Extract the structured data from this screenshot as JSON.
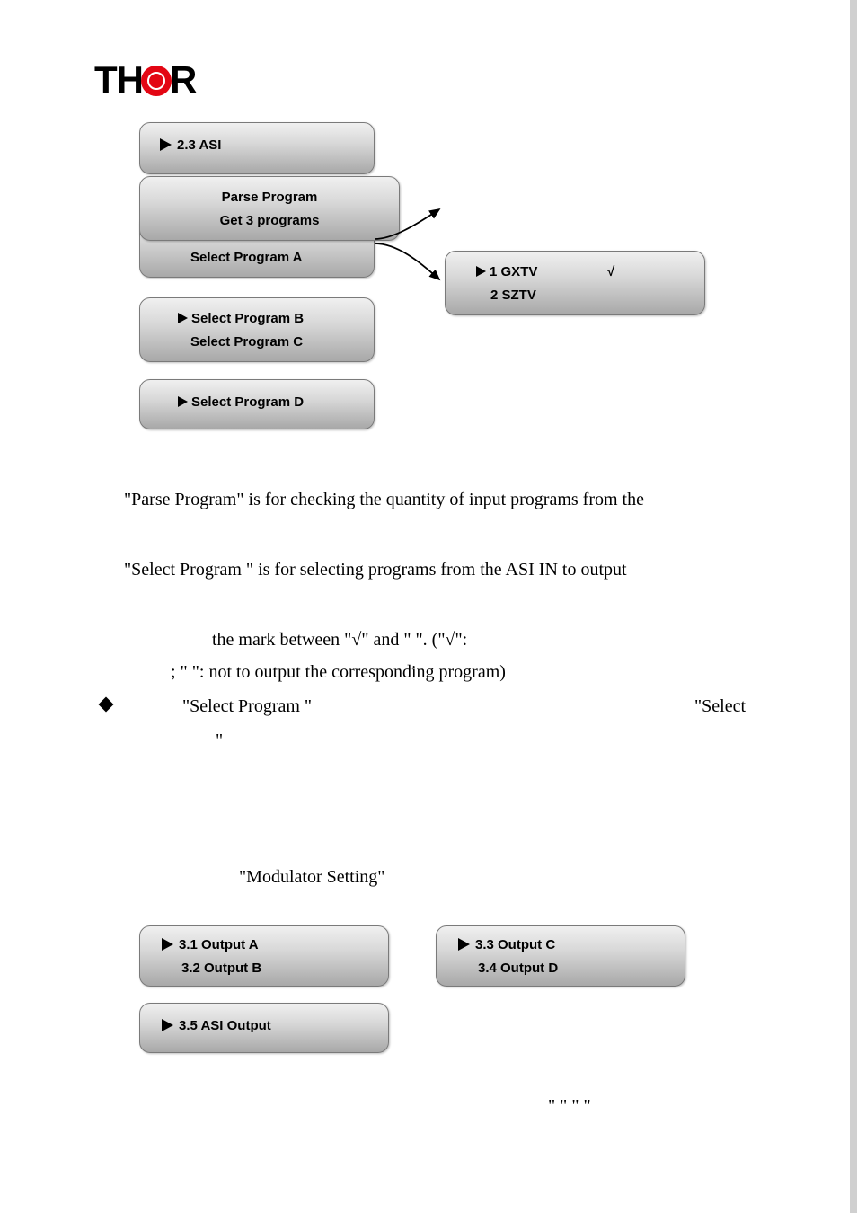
{
  "logo": {
    "left": "TH",
    "right": "R"
  },
  "diagram1": {
    "box_asi": {
      "line1": "2.3 ASI"
    },
    "box_parse_select_a": {
      "line1": "Parse Program",
      "line2": "Select Program A"
    },
    "box_select_bc": {
      "line1": "Select Program B",
      "line2": "Select Program C"
    },
    "box_select_d": {
      "line1": "Select Program D"
    },
    "box_parse_result": {
      "line1": "Parse Program",
      "line2": "Get 3 programs"
    },
    "box_channels": {
      "line1": "1 GXTV",
      "tick": "√",
      "line2": "2 SZTV"
    }
  },
  "text1": "\"Parse Program\" is for checking the quantity of input programs from the",
  "text2": "\"Select Program    \" is for selecting programs from the ASI IN to output",
  "text3_line1_a": "the mark between \"",
  "text3_line1_tick": "√",
  "text3_line1_b": "\" and \"  \". (\"",
  "text3_line1_tick2": "√",
  "text3_line1_c": "\":",
  "text3_line2": "; \"  \": not to output the corresponding program)",
  "text4_a": "\"Select Program         \"",
  "text4_b": "\"Select",
  "text4_c": "\"",
  "text5": "\"Modulator Setting\"",
  "diagram2": {
    "box_ab": {
      "line1": "3.1 Output A",
      "line2": "3.2 Output B"
    },
    "box_cd": {
      "line1": "3.3 Output C",
      "line2": "3.4 Output D"
    },
    "box_asi_out": {
      "line1": "3.5 ASI Output"
    }
  },
  "tail_quotes": "\"     \" \"     \""
}
